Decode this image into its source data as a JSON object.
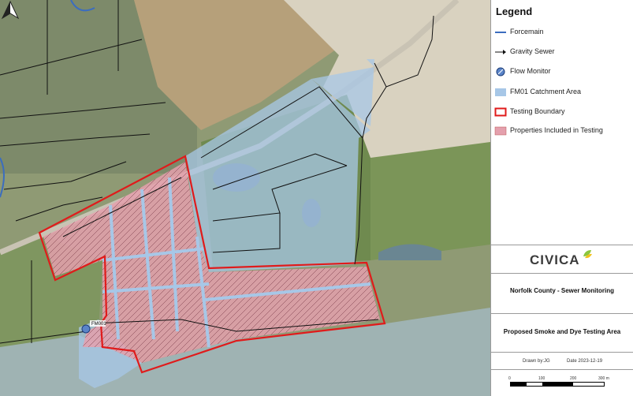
{
  "map": {
    "label_fm01": "FM001",
    "colors": {
      "forcemain": "#3b6dbf",
      "gravity": "#111111",
      "catchment_fill": "#a7c7e7",
      "boundary": "#e01b1b",
      "properties_fill": "#e4a0ad"
    }
  },
  "north_arrow_icon": "north-arrow-icon",
  "legend": {
    "title": "Legend",
    "items": [
      {
        "label": "Forcemain",
        "icon": "forcemain-line-icon"
      },
      {
        "label": "Gravity Sewer",
        "icon": "gravity-sewer-icon"
      },
      {
        "label": "Flow Monitor",
        "icon": "flow-monitor-icon"
      },
      {
        "label": "FM01 Catchment Area",
        "icon": "catchment-area-icon"
      },
      {
        "label": "Testing Boundary",
        "icon": "testing-boundary-icon"
      },
      {
        "label": "Properties Included in Testing",
        "icon": "properties-icon"
      }
    ]
  },
  "logo": {
    "text": "CIVICA",
    "icon": "civica-leaf-icon"
  },
  "project_title": "Norfolk County - Sewer Monitoring",
  "drawing_title": "Proposed Smoke and Dye Testing Area",
  "drawn_by": "Drawn by:JG",
  "date": "Date 2023-12-19",
  "scale": {
    "labels": [
      "0",
      "100",
      "200",
      "300 m"
    ]
  }
}
